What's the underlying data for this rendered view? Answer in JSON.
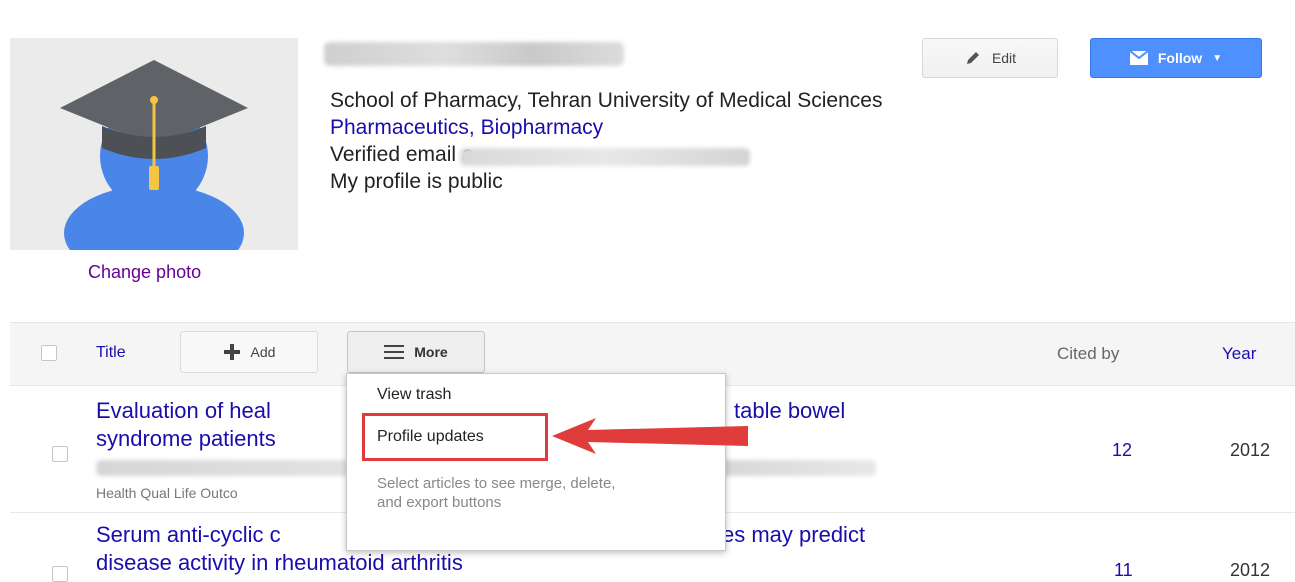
{
  "profile": {
    "change_photo_label": "Change photo",
    "affiliation": "School of Pharmacy, Tehran University of Medical Sciences",
    "interests": [
      "Pharmaceutics",
      "Biopharmacy"
    ],
    "interests_separator": ", ",
    "email_label": "Verified email a",
    "public_status": "My profile is public",
    "edit_label": "Edit",
    "follow_label": "Follow"
  },
  "table": {
    "title_col": "Title",
    "add_label": "Add",
    "more_label": "More",
    "cited_by_col": "Cited by",
    "year_col": "Year"
  },
  "more_menu": {
    "items": [
      "View trash",
      "Profile updates"
    ],
    "note": "Select articles to see merge, delete, and export buttons"
  },
  "articles": [
    {
      "title_line1_left": "Evaluation of heal",
      "title_line1_right": "table bowel",
      "title_line2": "syndrome patients",
      "venue": "Health Qual Life Outco",
      "cited_by": "12",
      "year": "2012"
    },
    {
      "title_line1_left": "Serum anti-cyclic c",
      "title_line1_right": "es may predict",
      "title_line2": "disease activity in rheumatoid arthritis",
      "cited_by": "11",
      "year": "2012"
    }
  ],
  "colors": {
    "link": "#1a0dab",
    "follow_button": "#4d90fe",
    "highlight": "#e03c3c",
    "avatar_cap": "#5f6368",
    "avatar_person": "#4a86e8",
    "tassel": "#f4c542"
  },
  "icons": {
    "edit": "pencil-icon",
    "follow": "envelope-icon",
    "add": "plus-icon",
    "more": "hamburger-icon"
  }
}
